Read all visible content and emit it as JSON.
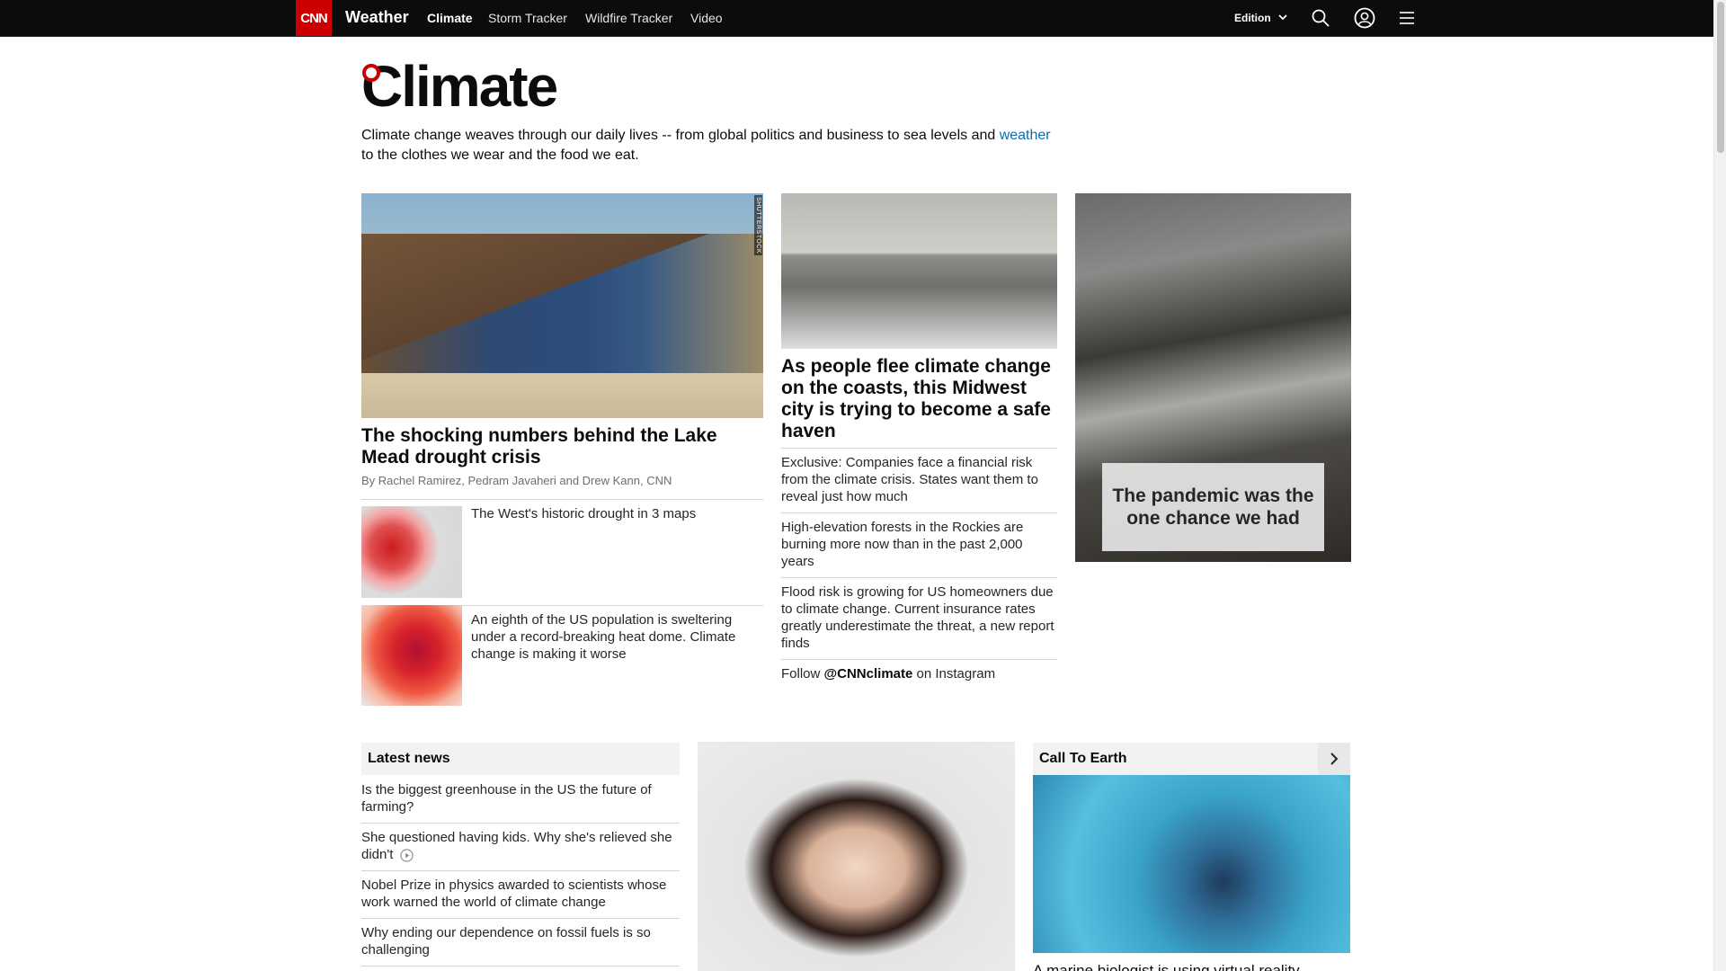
{
  "nav": {
    "logo": "CNN",
    "section": "Weather",
    "links": [
      "Climate",
      "Storm Tracker",
      "Wildfire Tracker",
      "Video"
    ],
    "edition": "Edition"
  },
  "page": {
    "title": "Climate",
    "intro_before": "Climate change weaves through our daily lives -- from global politics and business to sea levels and ",
    "intro_link": "weather",
    "intro_after": " to the clothes we wear and the food we eat."
  },
  "lead": {
    "image_credit": "SHUTTERSTOCK",
    "headline": "The shocking numbers behind the Lake Mead drought crisis",
    "byline": "By Rachel Ramirez, Pedram Javaheri and Drew Kann, CNN",
    "related": [
      "The West's historic drought in 3 maps",
      "An eighth of the US population is sweltering under a record-breaking heat dome. Climate change is making it worse"
    ]
  },
  "middle": {
    "headline": "As people flee climate change on the coasts, this Midwest city is trying to become a safe haven",
    "links": [
      "Exclusive: Companies face a financial risk from the climate crisis. States want them to reveal just how much",
      "High-elevation forests in the Rockies are burning more now than in the past 2,000 years",
      "Flood risk is growing for US homeowners due to climate change. Current insurance rates greatly underestimate the threat, a new report finds"
    ],
    "follow_prefix": "Follow ",
    "follow_handle": "@CNNclimate",
    "follow_suffix": " on Instagram"
  },
  "feature": {
    "caption": "The pandemic was the one chance we had"
  },
  "latest": {
    "heading": "Latest news",
    "items": [
      "Is the biggest greenhouse in the US the future of farming?",
      "She questioned having kids. Why she's relieved she didn't",
      "Nobel Prize in physics awarded to scientists whose work warned the world of climate change",
      "Why ending our dependence on fossil fuels is so challenging"
    ]
  },
  "call_to_earth": {
    "heading": "Call To Earth",
    "teaser": "A marine biologist is using virtual reality"
  }
}
